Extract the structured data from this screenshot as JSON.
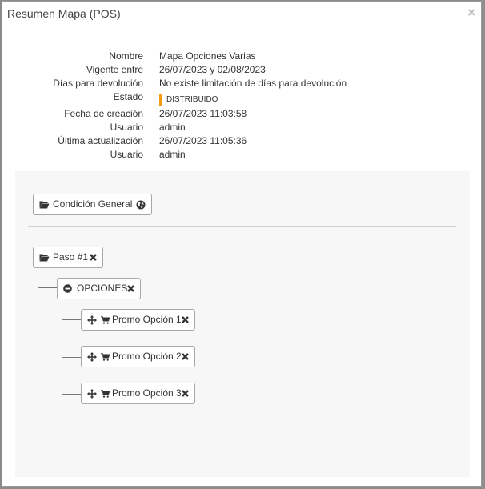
{
  "modal": {
    "title": "Resumen Mapa (POS)",
    "close_symbol": "×"
  },
  "summary": {
    "rows": [
      {
        "label": "Nombre",
        "value": "Mapa Opciones Varias"
      },
      {
        "label": "Vigente entre",
        "value": "26/07/2023 y 02/08/2023"
      },
      {
        "label": "Días para devolución",
        "value": "No existe limitación de días para devolución"
      },
      {
        "label": "Estado",
        "value": ""
      },
      {
        "label": "Fecha de creación",
        "value": "26/07/2023 11:03:58"
      },
      {
        "label": "Usuario",
        "value": "admin"
      },
      {
        "label": "Última actualización",
        "value": "26/07/2023 11:05:36"
      },
      {
        "label": "Usuario",
        "value": "admin"
      }
    ],
    "status_badge": "DISTRIBUIDO",
    "status_color": "#f39c12"
  },
  "tree": {
    "general_condition": {
      "label": "Condición General",
      "icons": [
        "folder-open-icon",
        "globe-icon"
      ]
    },
    "step": {
      "label": "Paso #1",
      "icons": [
        "folder-open-icon",
        "remove-icon"
      ]
    },
    "options_group": {
      "label": "OPCIONES",
      "icons": [
        "minus-circle-icon",
        "remove-icon"
      ]
    },
    "options": [
      {
        "label": "Promo Opción 1",
        "icons": [
          "move-icon",
          "cart-icon",
          "remove-icon"
        ]
      },
      {
        "label": "Promo Opción 2",
        "icons": [
          "move-icon",
          "cart-icon",
          "remove-icon"
        ]
      },
      {
        "label": "Promo Opción 3",
        "icons": [
          "move-icon",
          "cart-icon",
          "remove-icon"
        ]
      }
    ]
  },
  "colors": {
    "header_accent": "#e8b325",
    "status_accent": "#f39c12"
  }
}
